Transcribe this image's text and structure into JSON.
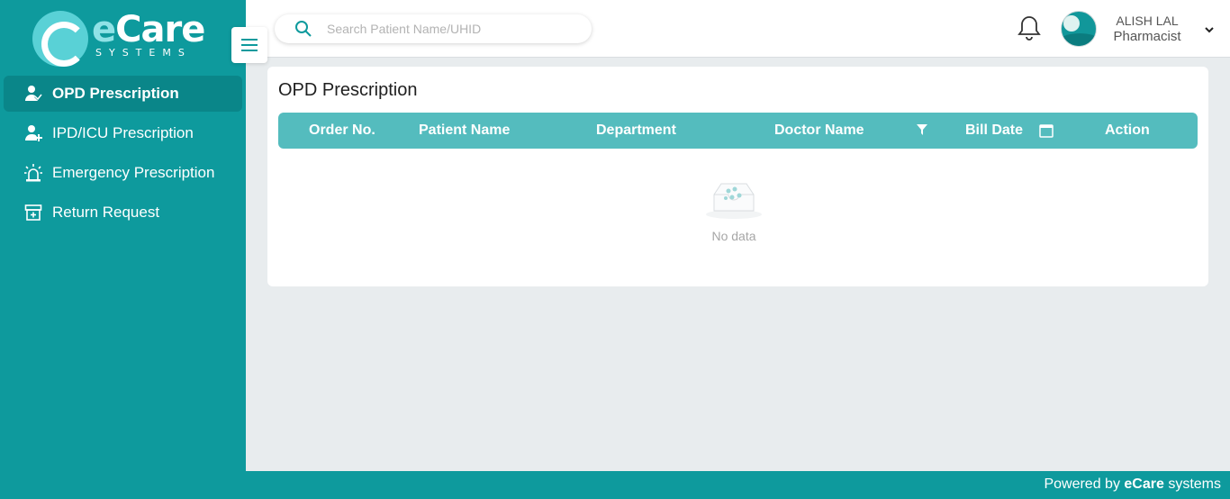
{
  "brand": {
    "name_e": "e",
    "name_rest": "Care",
    "subtitle": "SYSTEMS"
  },
  "sidebar": {
    "items": [
      {
        "label": "OPD Prescription",
        "icon": "user-prescription-icon",
        "active": true
      },
      {
        "label": "IPD/ICU Prescription",
        "icon": "user-plus-icon",
        "active": false
      },
      {
        "label": "Emergency Prescription",
        "icon": "siren-icon",
        "active": false
      },
      {
        "label": "Return Request",
        "icon": "archive-icon",
        "active": false
      }
    ]
  },
  "header": {
    "search_placeholder": "Search Patient Name/UHID",
    "user_name": "ALISH LAL",
    "user_role": "Pharmacist"
  },
  "main": {
    "title": "OPD Prescription",
    "columns": [
      "Order No.",
      "Patient Name",
      "Department",
      "Doctor Name",
      "Bill Date",
      "Action"
    ],
    "empty_text": "No data"
  },
  "footer": {
    "prefix": "Powered by ",
    "brand": "eCare",
    "suffix": " systems"
  },
  "colors": {
    "primary": "#0e9a9d",
    "primary_dark": "#0a8689",
    "table_header": "#54bcbe",
    "background": "#e8ecee"
  }
}
